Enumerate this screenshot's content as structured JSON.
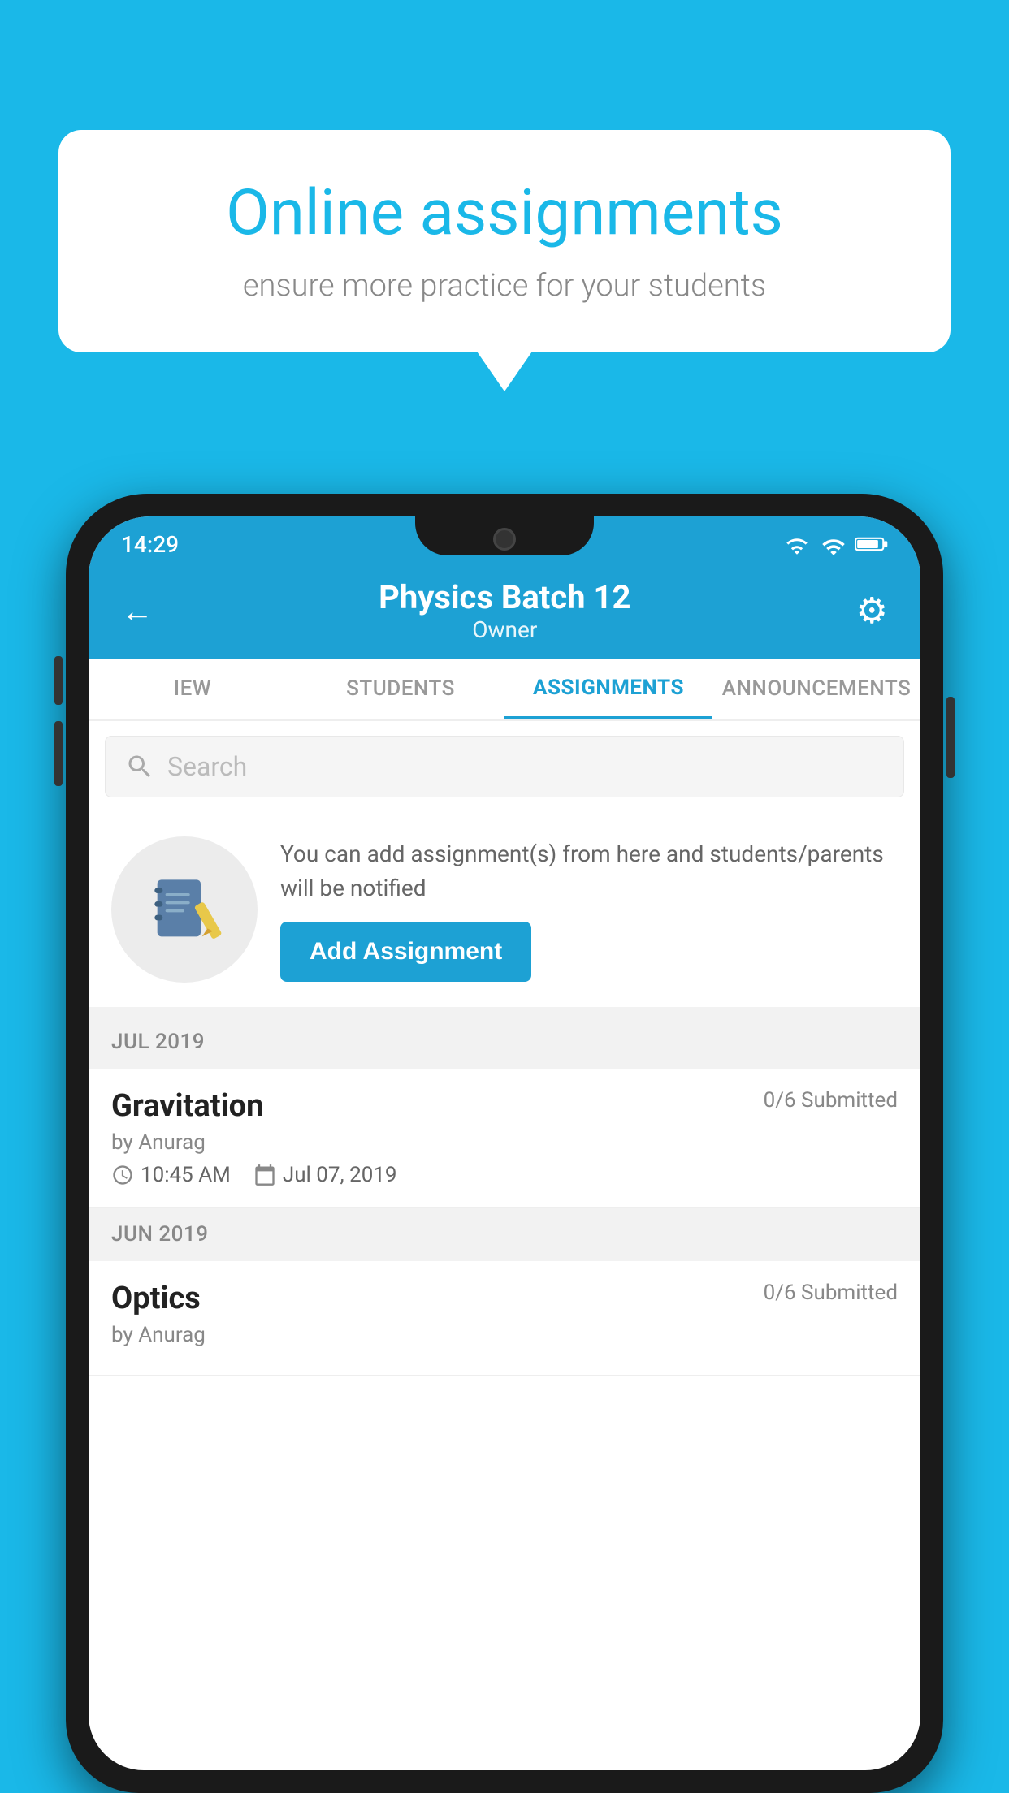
{
  "background": {
    "color": "#1ab8e8"
  },
  "speech_bubble": {
    "title": "Online assignments",
    "subtitle": "ensure more practice for your students"
  },
  "phone": {
    "status_bar": {
      "time": "14:29",
      "icons": "wifi signal battery"
    },
    "header": {
      "title": "Physics Batch 12",
      "subtitle": "Owner",
      "back_label": "←",
      "settings_label": "⚙"
    },
    "tabs": [
      {
        "label": "IEW",
        "active": false
      },
      {
        "label": "STUDENTS",
        "active": false
      },
      {
        "label": "ASSIGNMENTS",
        "active": true
      },
      {
        "label": "ANNOUNCEMENTS",
        "active": false
      }
    ],
    "search": {
      "placeholder": "Search"
    },
    "promo": {
      "text": "You can add assignment(s) from here and students/parents will be notified",
      "button_label": "Add Assignment"
    },
    "sections": [
      {
        "label": "JUL 2019",
        "assignments": [
          {
            "title": "Gravitation",
            "submitted": "0/6 Submitted",
            "by": "by Anurag",
            "time": "10:45 AM",
            "date": "Jul 07, 2019"
          }
        ]
      },
      {
        "label": "JUN 2019",
        "assignments": [
          {
            "title": "Optics",
            "submitted": "0/6 Submitted",
            "by": "by Anurag",
            "time": "",
            "date": ""
          }
        ]
      }
    ]
  }
}
